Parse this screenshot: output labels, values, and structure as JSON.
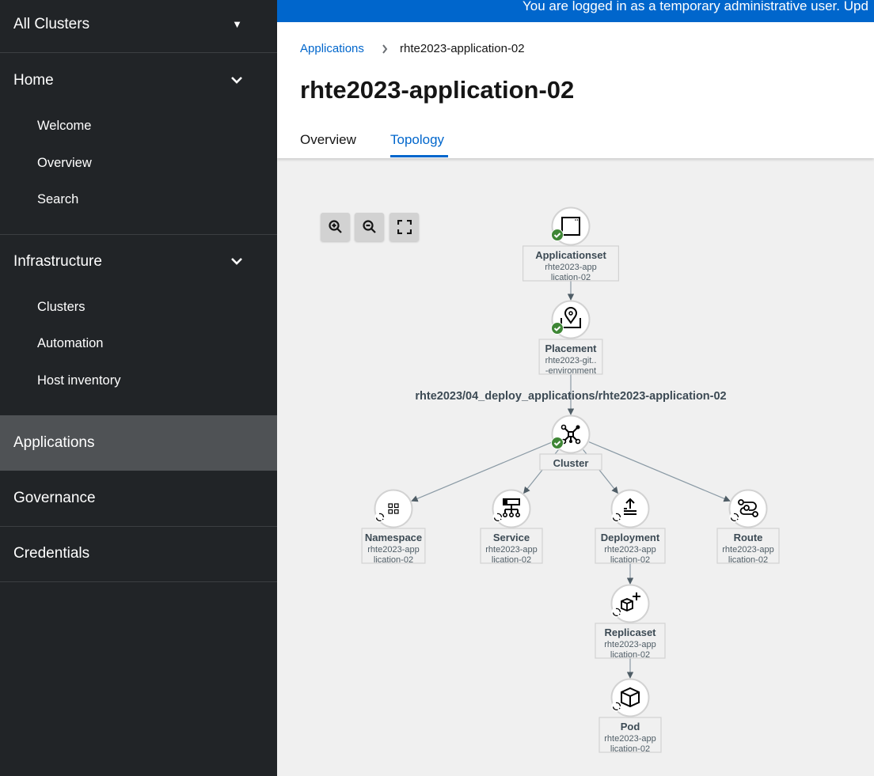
{
  "sidebar": {
    "cluster_switcher": "All Clusters",
    "home": {
      "label": "Home",
      "items": [
        "Welcome",
        "Overview",
        "Search"
      ]
    },
    "infrastructure": {
      "label": "Infrastructure",
      "items": [
        "Clusters",
        "Automation",
        "Host inventory"
      ]
    },
    "applications": "Applications",
    "governance": "Governance",
    "credentials": "Credentials"
  },
  "banner": "You are logged in as a temporary administrative user. Upd",
  "breadcrumb": {
    "parent": "Applications",
    "current": "rhte2023-application-02"
  },
  "title": "rhte2023-application-02",
  "tabs": [
    {
      "label": "Overview",
      "active": false
    },
    {
      "label": "Topology",
      "active": true
    }
  ],
  "topology": {
    "group_label": "rhte2023/04_deploy_applications/rhte2023-application-02",
    "colors": {
      "success": "#3e8635",
      "edge": "#8a9aa5",
      "arrow": "#4f5d66"
    },
    "nodes": [
      {
        "id": "appset",
        "type": "Applicationset",
        "name": [
          "rhte2023-app",
          "lication-02"
        ],
        "status": "success",
        "icon": "window-icon"
      },
      {
        "id": "placement",
        "type": "Placement",
        "name": [
          "rhte2023-git..",
          "-environment"
        ],
        "status": "success",
        "icon": "placement-icon"
      },
      {
        "id": "cluster",
        "type": "Cluster",
        "name": [],
        "status": "success",
        "icon": "cluster-icon"
      },
      {
        "id": "namespace",
        "type": "Namespace",
        "name": [
          "rhte2023-app",
          "lication-02"
        ],
        "status": "pending",
        "icon": "namespace-icon"
      },
      {
        "id": "service",
        "type": "Service",
        "name": [
          "rhte2023-app",
          "lication-02"
        ],
        "status": "pending",
        "icon": "service-icon"
      },
      {
        "id": "deployment",
        "type": "Deployment",
        "name": [
          "rhte2023-app",
          "lication-02"
        ],
        "status": "pending",
        "icon": "deployment-icon"
      },
      {
        "id": "route",
        "type": "Route",
        "name": [
          "rhte2023-app",
          "lication-02"
        ],
        "status": "pending",
        "icon": "route-icon"
      },
      {
        "id": "replicaset",
        "type": "Replicaset",
        "name": [
          "rhte2023-app",
          "lication-02"
        ],
        "status": "pending",
        "icon": "replicaset-icon"
      },
      {
        "id": "pod",
        "type": "Pod",
        "name": [
          "rhte2023-app",
          "lication-02"
        ],
        "status": "pending",
        "icon": "pod-icon"
      }
    ],
    "edges": [
      [
        "appset",
        "placement"
      ],
      [
        "placement",
        "cluster"
      ],
      [
        "cluster",
        "namespace"
      ],
      [
        "cluster",
        "service"
      ],
      [
        "cluster",
        "deployment"
      ],
      [
        "cluster",
        "route"
      ],
      [
        "deployment",
        "replicaset"
      ],
      [
        "replicaset",
        "pod"
      ]
    ]
  }
}
